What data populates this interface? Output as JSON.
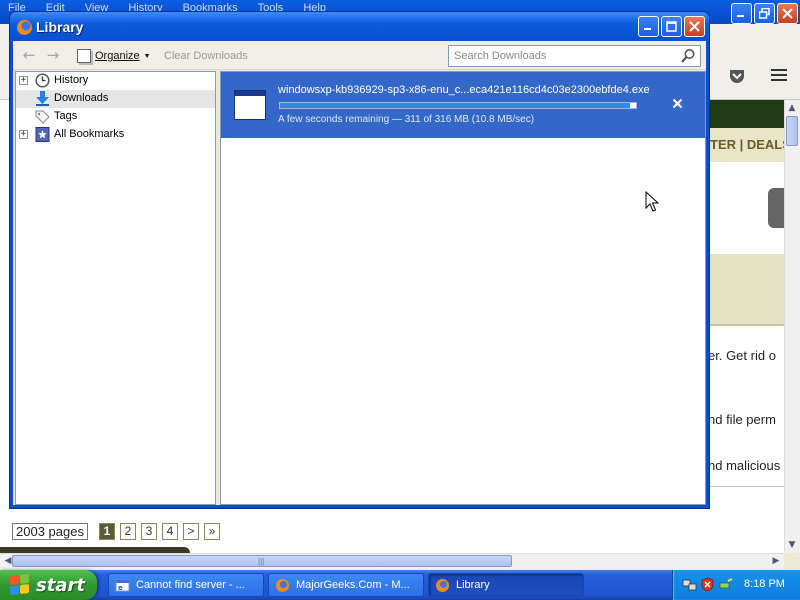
{
  "background_window": {
    "menu": [
      "File",
      "Edit",
      "View",
      "History",
      "Bookmarks",
      "Tools",
      "Help"
    ],
    "header_text": "TER | DEALS",
    "body_lines": [
      "er. Get rid o",
      "nd file perm",
      "nd malicious"
    ],
    "pager": {
      "label": "2003 pages",
      "pages": [
        "1",
        "2",
        "3",
        "4",
        ">",
        "»"
      ],
      "active_index": 0
    }
  },
  "library": {
    "title": "Library",
    "toolbar": {
      "organize_label": "Organize",
      "clear_label": "Clear Downloads",
      "search_placeholder": "Search Downloads"
    },
    "tree": [
      {
        "label": "History",
        "icon": "clock-icon",
        "expandable": true,
        "selected": false
      },
      {
        "label": "Downloads",
        "icon": "download-arrow-icon",
        "expandable": false,
        "selected": true
      },
      {
        "label": "Tags",
        "icon": "tag-icon",
        "expandable": false,
        "selected": false
      },
      {
        "label": "All Bookmarks",
        "icon": "bookmarks-star-icon",
        "expandable": true,
        "selected": false
      }
    ],
    "download": {
      "filename": "windowsxp-kb936929-sp3-x86-enu_c...eca421e116cd4c03e2300ebfde4.exe",
      "status": "A few seconds remaining — 311 of 316 MB (10.8 MB/sec)",
      "progress": 0.984
    }
  },
  "taskbar": {
    "start_label": "start",
    "tasks": [
      {
        "label": "Cannot find server - ...",
        "icon": "ie-icon",
        "active": false
      },
      {
        "label": "MajorGeeks.Com - M...",
        "icon": "firefox-icon",
        "active": false
      },
      {
        "label": "Library",
        "icon": "firefox-icon",
        "active": true
      }
    ],
    "clock": "8:18 PM"
  },
  "colors": {
    "selection_blue": "#3468c8",
    "progress_fill": "#2e8bea",
    "xp_title_blue": "#0a50d0",
    "start_green": "#2f9a2f",
    "site_olive": "#1f3c17"
  }
}
